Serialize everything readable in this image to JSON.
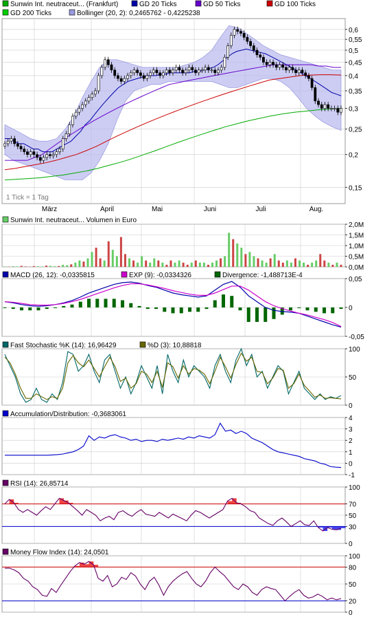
{
  "colors": {
    "bg": "#ffffff",
    "grid": "#cccccc",
    "candle_up": "#ffffff",
    "candle_down": "#000000",
    "ma20": "#0000aa",
    "ma50": "#6600cc",
    "ma100": "#cc0000",
    "ma200": "#00aa00",
    "bollinger_fill": "#b8b8ee",
    "bollinger_line": "#8888dd",
    "vol_up": "#66cc66",
    "vol_down": "#cc4444",
    "macd": "#0000aa",
    "exp": "#cc00cc",
    "divergence": "#006600",
    "stoch_k": "#006666",
    "stoch_d": "#666600",
    "ad": "#0000cc",
    "rsi": "#660066",
    "mfi": "#660066",
    "ref_upper": "#cc0000",
    "ref_lower": "#0000cc",
    "overbought_fill": "#ee4444",
    "oversold_fill": "#4444ee"
  },
  "legends": {
    "price": [
      {
        "label": "Sunwin Int. neutraceut... (Frankfurt)",
        "color": "#00aa00"
      },
      {
        "label": "GD 20 Ticks",
        "color": "#0000aa"
      },
      {
        "label": "GD 50 Ticks",
        "color": "#6600cc"
      },
      {
        "label": "GD 100 Ticks",
        "color": "#cc0000"
      },
      {
        "label": "GD 200 Ticks",
        "color": "#00cc00"
      },
      {
        "label": "Bollinger (20, 2): 0,2465762 - 0,4225238",
        "color": "#9999dd"
      }
    ],
    "volume": [
      {
        "label": "Sunwin Int. neutraceut... Volumen in Euro",
        "color": "#66cc66"
      }
    ],
    "macd": [
      {
        "label": "MACD (26, 12): -0,0335815",
        "color": "#0000aa"
      },
      {
        "label": "EXP (9): -0,0334326",
        "color": "#cc00cc"
      },
      {
        "label": "Divergence: -1,488713E-4",
        "color": "#006600"
      }
    ],
    "stoch": [
      {
        "label": "Fast Stochastic %K (14): 16,96429",
        "color": "#006666"
      },
      {
        "label": "%D (3): 10,88818",
        "color": "#666600"
      }
    ],
    "ad": [
      {
        "label": "Accumulation/Distribution: -0,3683061",
        "color": "#0000cc"
      }
    ],
    "rsi": [
      {
        "label": "RSI (14): 26,85714",
        "color": "#660066"
      }
    ],
    "mfi": [
      {
        "label": "Money Flow Index (14): 24,0501",
        "color": "#660066"
      }
    ]
  },
  "price_note": "1 Tick = 1 Tag",
  "x_months": [
    "März",
    "April",
    "Mai",
    "Juni",
    "Juli",
    "Aug."
  ],
  "chart_data": [
    {
      "type": "candlestick",
      "name": "price",
      "log_scale": true,
      "ylim": [
        0.13,
        0.66
      ],
      "yticks": [
        0.15,
        0.2,
        0.25,
        0.3,
        0.35,
        0.4,
        0.45,
        0.5,
        0.55,
        0.6
      ],
      "ytick_labels": [
        "0,15",
        "0,2",
        "0,25",
        "0,3",
        "0,35",
        "0,4",
        "0,45",
        "0,5",
        "0,55",
        "0,6"
      ],
      "x_months": [
        "März",
        "April",
        "Mai",
        "Juni",
        "Juli",
        "Aug."
      ],
      "close": [
        0.22,
        0.225,
        0.23,
        0.22,
        0.215,
        0.21,
        0.205,
        0.2,
        0.205,
        0.2,
        0.195,
        0.19,
        0.195,
        0.2,
        0.198,
        0.2,
        0.205,
        0.21,
        0.23,
        0.24,
        0.26,
        0.28,
        0.29,
        0.3,
        0.31,
        0.32,
        0.33,
        0.34,
        0.35,
        0.4,
        0.43,
        0.46,
        0.44,
        0.42,
        0.4,
        0.39,
        0.38,
        0.39,
        0.4,
        0.41,
        0.42,
        0.41,
        0.4,
        0.39,
        0.4,
        0.41,
        0.42,
        0.41,
        0.4,
        0.41,
        0.42,
        0.41,
        0.42,
        0.43,
        0.42,
        0.41,
        0.42,
        0.43,
        0.42,
        0.41,
        0.42,
        0.42,
        0.43,
        0.42,
        0.42,
        0.41,
        0.42,
        0.43,
        0.47,
        0.52,
        0.57,
        0.6,
        0.59,
        0.58,
        0.56,
        0.54,
        0.52,
        0.5,
        0.48,
        0.47,
        0.45,
        0.44,
        0.45,
        0.44,
        0.43,
        0.44,
        0.43,
        0.42,
        0.43,
        0.42,
        0.41,
        0.42,
        0.41,
        0.4,
        0.39,
        0.36,
        0.32,
        0.31,
        0.3,
        0.31,
        0.3,
        0.3,
        0.3,
        0.29,
        0.3
      ],
      "series": [
        {
          "name": "GD 20 Ticks",
          "values": [
            0.23,
            0.23,
            0.225,
            0.22,
            0.22,
            0.215,
            0.21,
            0.21,
            0.205,
            0.205,
            0.205,
            0.21,
            0.215,
            0.22,
            0.225,
            0.235,
            0.245,
            0.26,
            0.27,
            0.285,
            0.3,
            0.315,
            0.33,
            0.345,
            0.36,
            0.37,
            0.38,
            0.385,
            0.39,
            0.395,
            0.4,
            0.4,
            0.4,
            0.405,
            0.405,
            0.41,
            0.41,
            0.41,
            0.41,
            0.41,
            0.415,
            0.415,
            0.42,
            0.425,
            0.43,
            0.44,
            0.455,
            0.47,
            0.485,
            0.495,
            0.5,
            0.505,
            0.5,
            0.495,
            0.49,
            0.485,
            0.475,
            0.465,
            0.455,
            0.445,
            0.435,
            0.425,
            0.415,
            0.405,
            0.395,
            0.385,
            0.375,
            0.365,
            0.355,
            0.345,
            0.34,
            0.335
          ]
        },
        {
          "name": "GD 50 Ticks",
          "values": [
            0.19,
            0.19,
            0.19,
            0.19,
            0.195,
            0.2,
            0.21,
            0.22,
            0.23,
            0.24,
            0.25,
            0.26,
            0.27,
            0.28,
            0.29,
            0.3,
            0.31,
            0.32,
            0.33,
            0.34,
            0.35,
            0.36,
            0.37,
            0.375,
            0.38,
            0.385,
            0.39,
            0.395,
            0.4,
            0.405,
            0.41,
            0.415,
            0.42,
            0.425,
            0.43,
            0.435,
            0.44,
            0.44,
            0.44,
            0.44,
            0.44,
            0.44,
            0.435,
            0.435,
            0.43,
            0.43
          ]
        },
        {
          "name": "GD 100 Ticks",
          "values": [
            0.175,
            0.177,
            0.18,
            0.183,
            0.186,
            0.19,
            0.195,
            0.2,
            0.207,
            0.215,
            0.225,
            0.235,
            0.245,
            0.255,
            0.265,
            0.275,
            0.285,
            0.295,
            0.305,
            0.315,
            0.325,
            0.335,
            0.345,
            0.355,
            0.365,
            0.375,
            0.385,
            0.39,
            0.395,
            0.4,
            0.402,
            0.403,
            0.403,
            0.402
          ]
        },
        {
          "name": "GD 200 Ticks",
          "values": [
            0.16,
            0.161,
            0.162,
            0.163,
            0.165,
            0.167,
            0.17,
            0.173,
            0.177,
            0.182,
            0.187,
            0.193,
            0.2,
            0.207,
            0.215,
            0.223,
            0.231,
            0.239,
            0.247,
            0.255,
            0.262,
            0.269,
            0.275,
            0.281,
            0.286,
            0.29,
            0.293,
            0.296,
            0.298,
            0.3
          ]
        }
      ],
      "bollinger": {
        "upper": [
          0.26,
          0.25,
          0.24,
          0.23,
          0.225,
          0.225,
          0.23,
          0.25,
          0.28,
          0.33,
          0.38,
          0.43,
          0.46,
          0.46,
          0.45,
          0.44,
          0.43,
          0.43,
          0.43,
          0.43,
          0.43,
          0.44,
          0.45,
          0.47,
          0.5,
          0.56,
          0.62,
          0.61,
          0.58,
          0.55,
          0.52,
          0.5,
          0.48,
          0.47,
          0.46,
          0.45,
          0.44,
          0.43,
          0.42,
          0.42
        ],
        "lower": [
          0.2,
          0.19,
          0.185,
          0.18,
          0.175,
          0.17,
          0.165,
          0.16,
          0.16,
          0.16,
          0.17,
          0.19,
          0.22,
          0.27,
          0.32,
          0.35,
          0.36,
          0.37,
          0.37,
          0.38,
          0.38,
          0.38,
          0.38,
          0.38,
          0.38,
          0.37,
          0.36,
          0.36,
          0.37,
          0.38,
          0.39,
          0.39,
          0.38,
          0.36,
          0.33,
          0.3,
          0.28,
          0.265,
          0.255,
          0.247
        ]
      }
    },
    {
      "type": "bar",
      "name": "volume",
      "ylim": [
        0,
        2.0
      ],
      "yticks": [
        0,
        0.5,
        1.0,
        1.5,
        2.0
      ],
      "ytick_labels": [
        "0,0M",
        "0,5M",
        "1,0M",
        "1,5M",
        "2,0M"
      ],
      "values": [
        0.02,
        0.01,
        0.03,
        0.02,
        0.05,
        0.02,
        0.01,
        0.04,
        0.03,
        0.02,
        0.06,
        0.05,
        0.03,
        0.04,
        0.1,
        0.08,
        0.12,
        0.2,
        0.3,
        0.25,
        0.4,
        0.7,
        0.9,
        0.4,
        0.3,
        1.2,
        0.8,
        0.5,
        1.4,
        0.6,
        0.4,
        0.3,
        0.2,
        0.5,
        0.3,
        0.2,
        0.4,
        0.3,
        0.2,
        0.1,
        0.3,
        0.2,
        0.3,
        0.2,
        0.1,
        0.2,
        0.3,
        0.2,
        0.2,
        0.1,
        0.2,
        0.3,
        0.4,
        0.5,
        1.6,
        1.3,
        1.1,
        0.9,
        0.6,
        0.7,
        0.5,
        0.4,
        0.3,
        0.2,
        0.4,
        0.6,
        0.3,
        0.2,
        0.3,
        0.2,
        0.4,
        0.3,
        0.2,
        0.1,
        0.2,
        0.3,
        0.6,
        0.3,
        0.2,
        0.1,
        0.2,
        0.1
      ]
    },
    {
      "type": "line",
      "name": "macd",
      "ylim": [
        -0.05,
        0.05
      ],
      "yticks": [
        -0.05,
        0,
        0.05
      ],
      "ytick_labels": [
        "-0,05",
        "0",
        "0,05"
      ],
      "series": [
        {
          "name": "MACD (26, 12)",
          "values": [
            0.01,
            0.008,
            0.005,
            0.003,
            0.002,
            0.003,
            0.005,
            0.008,
            0.012,
            0.018,
            0.025,
            0.03,
            0.035,
            0.04,
            0.043,
            0.044,
            0.042,
            0.038,
            0.035,
            0.03,
            0.025,
            0.022,
            0.02,
            0.018,
            0.02,
            0.03,
            0.04,
            0.045,
            0.035,
            0.02,
            0.01,
            0.0,
            -0.005,
            -0.007,
            -0.008,
            -0.01,
            -0.015,
            -0.02,
            -0.025,
            -0.03,
            -0.034
          ]
        },
        {
          "name": "EXP (9)",
          "values": [
            0.01,
            0.009,
            0.007,
            0.005,
            0.004,
            0.004,
            0.005,
            0.007,
            0.01,
            0.014,
            0.019,
            0.024,
            0.029,
            0.034,
            0.038,
            0.041,
            0.041,
            0.039,
            0.036,
            0.033,
            0.029,
            0.026,
            0.023,
            0.021,
            0.021,
            0.025,
            0.031,
            0.037,
            0.037,
            0.03,
            0.02,
            0.01,
            0.003,
            -0.002,
            -0.006,
            -0.01,
            -0.013,
            -0.017,
            -0.021,
            -0.026,
            -0.033
          ]
        }
      ],
      "divergence": [
        0.0,
        -0.001,
        -0.002,
        -0.002,
        -0.002,
        -0.001,
        0.0,
        0.001,
        0.002,
        0.004,
        0.006,
        0.006,
        0.006,
        0.006,
        0.005,
        0.003,
        0.001,
        -0.001,
        -0.001,
        -0.003,
        -0.004,
        -0.004,
        -0.003,
        -0.003,
        -0.001,
        0.005,
        0.009,
        0.008,
        -0.002,
        -0.01,
        -0.01,
        -0.01,
        -0.008,
        -0.005,
        -0.002,
        0.0,
        -0.002,
        -0.003,
        -0.004,
        -0.004,
        -0.001
      ]
    },
    {
      "type": "line",
      "name": "stochastic",
      "ylim": [
        0,
        100
      ],
      "yticks": [
        0,
        50,
        100
      ],
      "ytick_labels": [
        "0",
        "50",
        "100"
      ],
      "series": [
        {
          "name": "Fast Stochastic %K (14)",
          "values": [
            90,
            70,
            50,
            20,
            5,
            10,
            30,
            10,
            5,
            20,
            10,
            40,
            95,
            90,
            60,
            70,
            90,
            60,
            40,
            80,
            90,
            60,
            30,
            50,
            20,
            40,
            70,
            50,
            30,
            70,
            20,
            90,
            60,
            40,
            80,
            50,
            70,
            60,
            50,
            30,
            70,
            90,
            60,
            40,
            80,
            100,
            70,
            90,
            50,
            60,
            30,
            50,
            70,
            60,
            20,
            40,
            60,
            30,
            20,
            10,
            20,
            10,
            15,
            12,
            17
          ]
        },
        {
          "name": "%D (3)",
          "values": [
            85,
            75,
            55,
            30,
            12,
            12,
            20,
            15,
            10,
            15,
            12,
            30,
            75,
            88,
            75,
            68,
            80,
            65,
            50,
            68,
            85,
            68,
            42,
            48,
            30,
            38,
            60,
            55,
            40,
            60,
            32,
            75,
            68,
            48,
            70,
            55,
            65,
            62,
            55,
            38,
            60,
            85,
            68,
            48,
            72,
            92,
            78,
            85,
            60,
            58,
            38,
            48,
            65,
            62,
            30,
            38,
            55,
            35,
            25,
            14,
            18,
            12,
            13,
            12,
            11
          ]
        }
      ]
    },
    {
      "type": "line",
      "name": "accumulation_distribution",
      "ylim": [
        -1,
        4
      ],
      "yticks": [
        -1,
        0,
        1,
        2,
        3,
        4
      ],
      "ytick_labels": [
        "-1",
        "0",
        "1",
        "2",
        "3",
        "4"
      ],
      "values": [
        0.7,
        0.7,
        0.7,
        0.7,
        0.7,
        0.7,
        0.7,
        0.7,
        0.7,
        0.72,
        0.75,
        0.8,
        0.9,
        1.0,
        1.2,
        1.5,
        2.4,
        2.0,
        2.3,
        2.2,
        2.4,
        2.5,
        2.3,
        2.2,
        2.0,
        2.1,
        1.9,
        2.0,
        2.0,
        1.9,
        2.1,
        2.0,
        2.1,
        2.2,
        2.1,
        2.3,
        2.2,
        2.4,
        2.3,
        2.2,
        2.5,
        3.5,
        2.8,
        2.9,
        2.6,
        2.8,
        2.6,
        2.2,
        2.0,
        1.8,
        1.5,
        1.2,
        1.0,
        0.9,
        0.8,
        0.7,
        0.6,
        0.4,
        0.3,
        0.2,
        0.0,
        -0.1,
        -0.3,
        -0.35,
        -0.37
      ]
    },
    {
      "type": "line",
      "name": "rsi",
      "ylim": [
        0,
        100
      ],
      "yticks": [
        0,
        30,
        50,
        70,
        100
      ],
      "ytick_labels": [
        "0",
        "30",
        "50",
        "70",
        "100"
      ],
      "reference_lines": [
        70,
        30
      ],
      "values": [
        70,
        78,
        72,
        60,
        55,
        60,
        55,
        50,
        58,
        65,
        60,
        70,
        80,
        76,
        72,
        65,
        58,
        50,
        60,
        55,
        50,
        40,
        45,
        48,
        42,
        55,
        58,
        52,
        48,
        55,
        60,
        52,
        50,
        48,
        55,
        50,
        45,
        52,
        48,
        44,
        40,
        50,
        58,
        55,
        50,
        45,
        50,
        55,
        60,
        75,
        80,
        72,
        70,
        65,
        58,
        55,
        45,
        40,
        35,
        32,
        40,
        45,
        38,
        30,
        35,
        40,
        33,
        32,
        40,
        28,
        22,
        28,
        25,
        24,
        27
      ]
    },
    {
      "type": "line",
      "name": "money_flow_index",
      "ylim": [
        0,
        100
      ],
      "yticks": [
        0,
        20,
        50,
        80,
        100
      ],
      "ytick_labels": [
        "0",
        "20",
        "50",
        "80",
        "100"
      ],
      "reference_lines": [
        80,
        20
      ],
      "values": [
        78,
        78,
        75,
        70,
        60,
        55,
        45,
        40,
        30,
        28,
        42,
        35,
        48,
        60,
        72,
        82,
        88,
        85,
        90,
        84,
        60,
        55,
        65,
        45,
        50,
        62,
        58,
        70,
        64,
        50,
        40,
        55,
        62,
        48,
        30,
        45,
        55,
        62,
        68,
        72,
        60,
        50,
        45,
        55,
        70,
        80,
        72,
        65,
        55,
        45,
        40,
        50,
        45,
        35,
        30,
        40,
        45,
        42,
        40,
        30,
        20,
        28,
        35,
        40,
        30,
        25,
        27,
        32,
        28,
        22,
        25,
        22,
        24
      ]
    }
  ]
}
